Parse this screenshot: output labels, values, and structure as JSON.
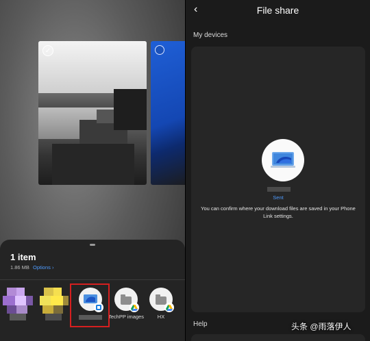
{
  "left_panel": {
    "sheet": {
      "item_count": "1 item",
      "size": "1.86 MB",
      "options_link": "Options",
      "options_chevron": "›"
    },
    "share_targets": [
      {
        "id": "phone-link-device",
        "label": "",
        "icon": "laptop-windows-icon"
      },
      {
        "id": "techpp-images",
        "label": "TechPP images",
        "icon": "folder-drive-icon"
      },
      {
        "id": "hx",
        "label": "HX",
        "icon": "folder-drive-icon"
      }
    ],
    "selection_check": "✓"
  },
  "right_panel": {
    "back_glyph": "‹",
    "title": "File share",
    "my_devices_label": "My devices",
    "status": "Sent",
    "info_text": "You can confirm where your download files are saved in your Phone Link settings.",
    "help_label": "Help"
  },
  "watermark": "头条 @雨落伊人",
  "colors": {
    "accent": "#4f9cff",
    "highlight_box": "#d61f1f",
    "sheet_bg": "#242424",
    "card_bg": "#262626"
  }
}
